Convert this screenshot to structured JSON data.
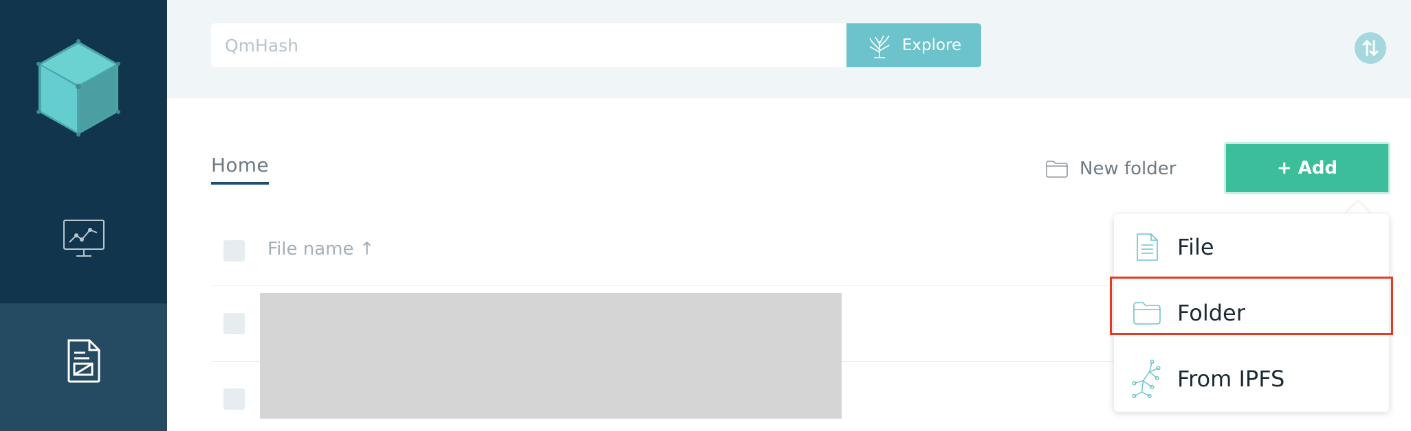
{
  "sidebar": {
    "logo_icon": "ipfs-cube-logo",
    "items": [
      {
        "icon": "status-monitor-icon",
        "active": false
      },
      {
        "icon": "files-document-icon",
        "active": true
      }
    ]
  },
  "header": {
    "search_placeholder": "QmHash",
    "explore_label": "Explore",
    "explore_icon": "tree-icon",
    "sync_icon": "up-down-arrows-icon"
  },
  "main": {
    "breadcrumb": "Home",
    "new_folder_label": "New folder",
    "add_label": "+ Add",
    "table": {
      "column_name": "File name ↑"
    }
  },
  "add_menu": {
    "items": [
      {
        "label": "File",
        "icon": "file-icon"
      },
      {
        "label": "Folder",
        "icon": "folder-icon"
      },
      {
        "label": "From IPFS",
        "icon": "ipfs-tree-icon"
      }
    ],
    "highlighted_item": "Folder"
  },
  "colors": {
    "sidebar_bg": "#11354d",
    "sidebar_active": "#244b62",
    "accent_teal": "#6dc3cb",
    "add_green": "#3cbe9a",
    "highlight_red": "#e53922"
  }
}
